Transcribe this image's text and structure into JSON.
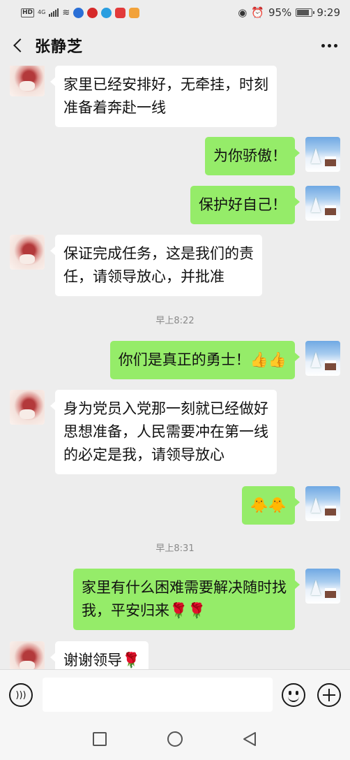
{
  "status": {
    "battery": "95%",
    "time": "9:29",
    "net": "4G"
  },
  "header": {
    "title": "张静芝"
  },
  "messages": [
    {
      "side": "left",
      "text": "家里已经安排好，无牵挂，时刻\n准备着奔赴一线"
    },
    {
      "side": "right",
      "text": "为你骄傲！"
    },
    {
      "side": "right",
      "text": "保护好自己！"
    },
    {
      "side": "left",
      "text": "保证完成任务，这是我们的责\n任，请领导放心，并批准"
    },
    {
      "side": "time",
      "text": "早上8:22"
    },
    {
      "side": "right",
      "text": "你们是真正的勇士！👍👍"
    },
    {
      "side": "left",
      "text": "身为党员入党那一刻就已经做好\n思想准备，人民需要冲在第一线\n的必定是我，请领导放心"
    },
    {
      "side": "right",
      "text": "🐥🐥"
    },
    {
      "side": "time",
      "text": "早上8:31"
    },
    {
      "side": "right",
      "text": "家里有什么困难需要解决随时找\n我，平安归来🌹🌹"
    },
    {
      "side": "left",
      "text": "谢谢领导🌹"
    }
  ],
  "icons": {
    "back": "back-arrow-icon",
    "more": "more-icon",
    "voice": "voice-icon",
    "emoji": "emoji-icon",
    "plus": "plus-icon"
  }
}
